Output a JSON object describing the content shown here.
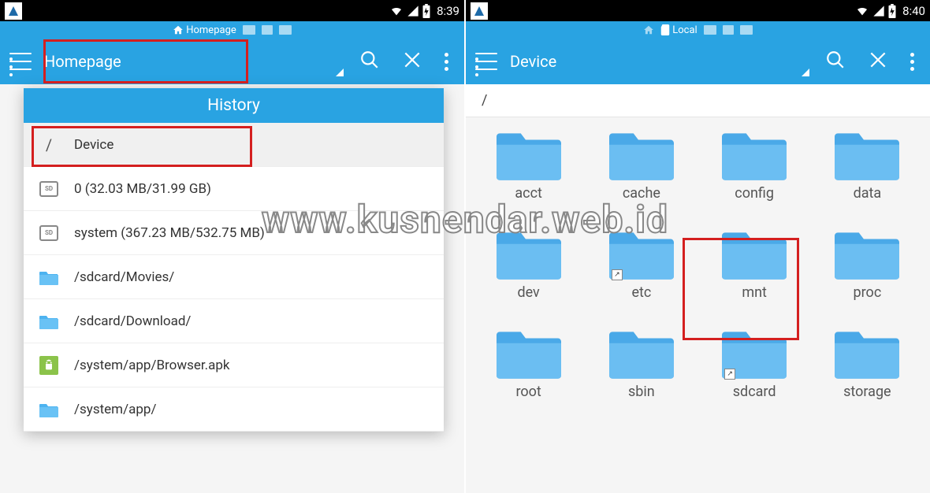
{
  "watermark": "www.kusnendar.web.id",
  "left": {
    "status": {
      "time": "8:39"
    },
    "breadcrumb": {
      "home": "Homepage"
    },
    "toolbar": {
      "title": "Homepage"
    },
    "dropdown": {
      "header": "History",
      "items": [
        {
          "icon": "slash",
          "label": "Device"
        },
        {
          "icon": "sd",
          "label": "0 (32.03 MB/31.99 GB)"
        },
        {
          "icon": "sd",
          "label": "system (367.23 MB/532.75 MB)"
        },
        {
          "icon": "folder",
          "label": "/sdcard/Movies/"
        },
        {
          "icon": "folder",
          "label": "/sdcard/Download/"
        },
        {
          "icon": "apk",
          "label": "/system/app/Browser.apk"
        },
        {
          "icon": "folder",
          "label": "/system/app/"
        }
      ]
    }
  },
  "right": {
    "status": {
      "time": "8:40"
    },
    "breadcrumb": {
      "local": "Local"
    },
    "toolbar": {
      "title": "Device"
    },
    "path": "/",
    "folders": [
      {
        "name": "acct",
        "link": false
      },
      {
        "name": "cache",
        "link": false
      },
      {
        "name": "config",
        "link": false
      },
      {
        "name": "data",
        "link": false
      },
      {
        "name": "dev",
        "link": false
      },
      {
        "name": "etc",
        "link": true
      },
      {
        "name": "mnt",
        "link": false
      },
      {
        "name": "proc",
        "link": false
      },
      {
        "name": "root",
        "link": false
      },
      {
        "name": "sbin",
        "link": false
      },
      {
        "name": "sdcard",
        "link": true
      },
      {
        "name": "storage",
        "link": false
      }
    ]
  }
}
